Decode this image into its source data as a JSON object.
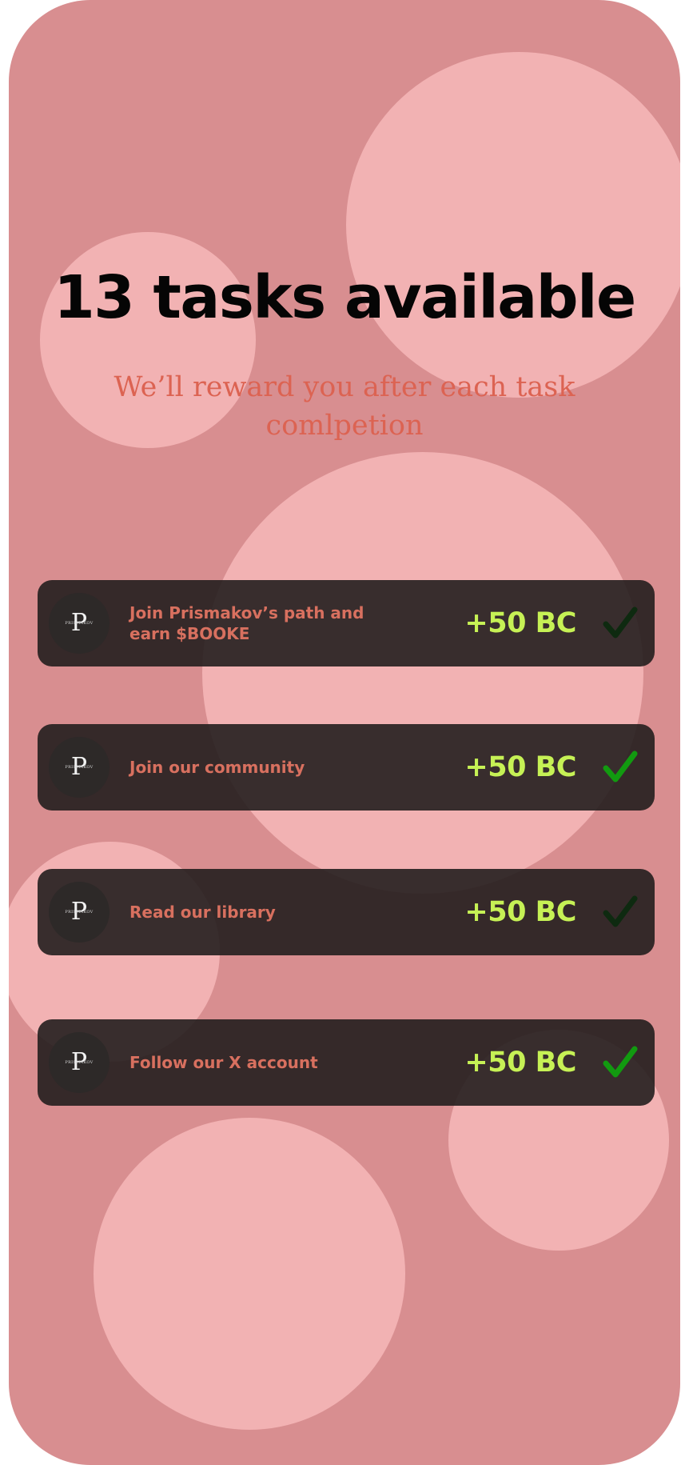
{
  "header": {
    "title": "13 tasks available",
    "subtitle": "We’ll reward you after each task comlpetion"
  },
  "logo": {
    "letter": "P",
    "wordmark": "PRISMAKOV"
  },
  "tasks": [
    {
      "title": "Join Prismakov’s path and earn $BOOKE",
      "reward": "+50 BC",
      "check_color": "#0e2a10",
      "completed": false
    },
    {
      "title": "Join our community",
      "reward": "+50 BC",
      "check_color": "#129a10",
      "completed": true
    },
    {
      "title": "Read our library",
      "reward": "+50 BC",
      "check_color": "#0e2a10",
      "completed": false
    },
    {
      "title": "Follow our X account",
      "reward": "+50 BC",
      "check_color": "#129a10",
      "completed": true
    }
  ],
  "colors": {
    "background": "#d88e90",
    "bubble": "#f2b2b3",
    "title": "#050505",
    "subtitle": "#dc6352",
    "card": "#2b2424",
    "task_text": "#d8705f",
    "reward": "#c6f155"
  }
}
